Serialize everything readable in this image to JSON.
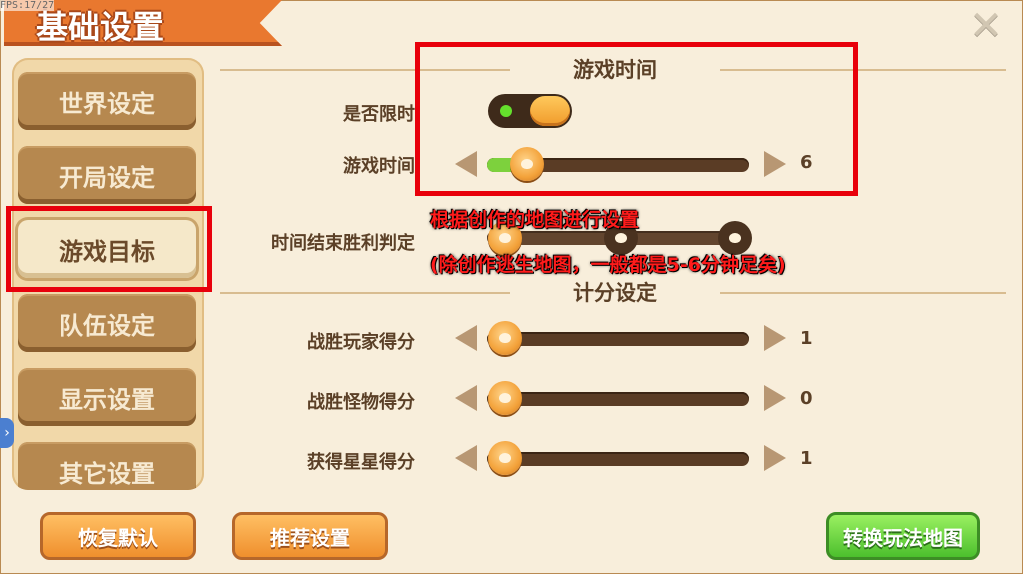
{
  "header": {
    "title": "基础设置",
    "fps_text": "FPS:17/27"
  },
  "sidebar": {
    "items": [
      {
        "label": "世界设定"
      },
      {
        "label": "开局设定"
      },
      {
        "label": "游戏目标"
      },
      {
        "label": "队伍设定"
      },
      {
        "label": "显示设置"
      },
      {
        "label": "其它设置"
      }
    ],
    "selected": "游戏目标"
  },
  "main": {
    "game_time": {
      "section_title": "游戏时间",
      "limit_label": "是否限时",
      "limit_enabled": true,
      "time_label": "游戏时间",
      "time_value": "6",
      "time_level": 0.1
    },
    "end_judgement": {
      "label": "时间结束胜利判定"
    },
    "scoring": {
      "section_title": "计分设定",
      "rows": [
        {
          "label": "战胜玩家得分",
          "value": "1"
        },
        {
          "label": "战胜怪物得分",
          "value": "0"
        },
        {
          "label": "获得星星得分",
          "value": "1"
        }
      ]
    }
  },
  "annotations": {
    "line1": "根据创作的地图进行设置",
    "line2": "(除创作逃生地图，一般都是5-6分钟足矣)"
  },
  "footer": {
    "restore_label": "恢复默认",
    "recommend_label": "推荐设置",
    "switch_label": "转换玩法地图"
  },
  "colors": {
    "highlight_border": "#e8000b",
    "annotation_text": "#ff1b1b",
    "slider_fill": "#7dd13d"
  }
}
